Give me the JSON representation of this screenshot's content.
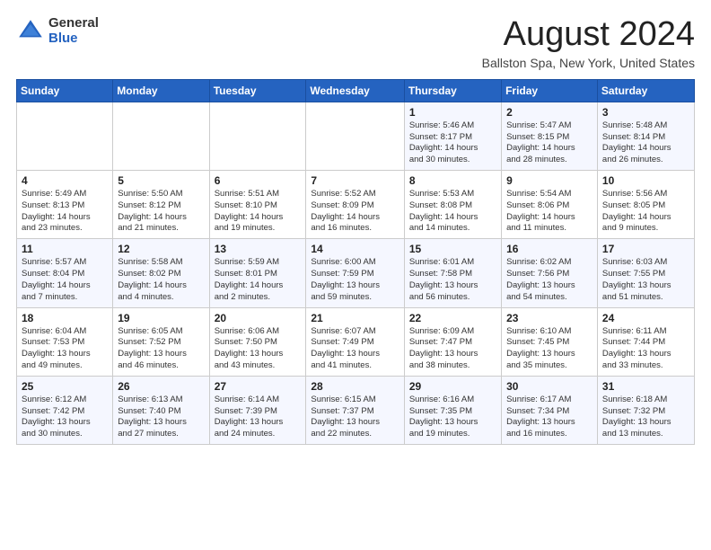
{
  "header": {
    "logo_general": "General",
    "logo_blue": "Blue",
    "month_title": "August 2024",
    "location": "Ballston Spa, New York, United States"
  },
  "weekdays": [
    "Sunday",
    "Monday",
    "Tuesday",
    "Wednesday",
    "Thursday",
    "Friday",
    "Saturday"
  ],
  "weeks": [
    [
      {
        "day": "",
        "info": ""
      },
      {
        "day": "",
        "info": ""
      },
      {
        "day": "",
        "info": ""
      },
      {
        "day": "",
        "info": ""
      },
      {
        "day": "1",
        "info": "Sunrise: 5:46 AM\nSunset: 8:17 PM\nDaylight: 14 hours\nand 30 minutes."
      },
      {
        "day": "2",
        "info": "Sunrise: 5:47 AM\nSunset: 8:15 PM\nDaylight: 14 hours\nand 28 minutes."
      },
      {
        "day": "3",
        "info": "Sunrise: 5:48 AM\nSunset: 8:14 PM\nDaylight: 14 hours\nand 26 minutes."
      }
    ],
    [
      {
        "day": "4",
        "info": "Sunrise: 5:49 AM\nSunset: 8:13 PM\nDaylight: 14 hours\nand 23 minutes."
      },
      {
        "day": "5",
        "info": "Sunrise: 5:50 AM\nSunset: 8:12 PM\nDaylight: 14 hours\nand 21 minutes."
      },
      {
        "day": "6",
        "info": "Sunrise: 5:51 AM\nSunset: 8:10 PM\nDaylight: 14 hours\nand 19 minutes."
      },
      {
        "day": "7",
        "info": "Sunrise: 5:52 AM\nSunset: 8:09 PM\nDaylight: 14 hours\nand 16 minutes."
      },
      {
        "day": "8",
        "info": "Sunrise: 5:53 AM\nSunset: 8:08 PM\nDaylight: 14 hours\nand 14 minutes."
      },
      {
        "day": "9",
        "info": "Sunrise: 5:54 AM\nSunset: 8:06 PM\nDaylight: 14 hours\nand 11 minutes."
      },
      {
        "day": "10",
        "info": "Sunrise: 5:56 AM\nSunset: 8:05 PM\nDaylight: 14 hours\nand 9 minutes."
      }
    ],
    [
      {
        "day": "11",
        "info": "Sunrise: 5:57 AM\nSunset: 8:04 PM\nDaylight: 14 hours\nand 7 minutes."
      },
      {
        "day": "12",
        "info": "Sunrise: 5:58 AM\nSunset: 8:02 PM\nDaylight: 14 hours\nand 4 minutes."
      },
      {
        "day": "13",
        "info": "Sunrise: 5:59 AM\nSunset: 8:01 PM\nDaylight: 14 hours\nand 2 minutes."
      },
      {
        "day": "14",
        "info": "Sunrise: 6:00 AM\nSunset: 7:59 PM\nDaylight: 13 hours\nand 59 minutes."
      },
      {
        "day": "15",
        "info": "Sunrise: 6:01 AM\nSunset: 7:58 PM\nDaylight: 13 hours\nand 56 minutes."
      },
      {
        "day": "16",
        "info": "Sunrise: 6:02 AM\nSunset: 7:56 PM\nDaylight: 13 hours\nand 54 minutes."
      },
      {
        "day": "17",
        "info": "Sunrise: 6:03 AM\nSunset: 7:55 PM\nDaylight: 13 hours\nand 51 minutes."
      }
    ],
    [
      {
        "day": "18",
        "info": "Sunrise: 6:04 AM\nSunset: 7:53 PM\nDaylight: 13 hours\nand 49 minutes."
      },
      {
        "day": "19",
        "info": "Sunrise: 6:05 AM\nSunset: 7:52 PM\nDaylight: 13 hours\nand 46 minutes."
      },
      {
        "day": "20",
        "info": "Sunrise: 6:06 AM\nSunset: 7:50 PM\nDaylight: 13 hours\nand 43 minutes."
      },
      {
        "day": "21",
        "info": "Sunrise: 6:07 AM\nSunset: 7:49 PM\nDaylight: 13 hours\nand 41 minutes."
      },
      {
        "day": "22",
        "info": "Sunrise: 6:09 AM\nSunset: 7:47 PM\nDaylight: 13 hours\nand 38 minutes."
      },
      {
        "day": "23",
        "info": "Sunrise: 6:10 AM\nSunset: 7:45 PM\nDaylight: 13 hours\nand 35 minutes."
      },
      {
        "day": "24",
        "info": "Sunrise: 6:11 AM\nSunset: 7:44 PM\nDaylight: 13 hours\nand 33 minutes."
      }
    ],
    [
      {
        "day": "25",
        "info": "Sunrise: 6:12 AM\nSunset: 7:42 PM\nDaylight: 13 hours\nand 30 minutes."
      },
      {
        "day": "26",
        "info": "Sunrise: 6:13 AM\nSunset: 7:40 PM\nDaylight: 13 hours\nand 27 minutes."
      },
      {
        "day": "27",
        "info": "Sunrise: 6:14 AM\nSunset: 7:39 PM\nDaylight: 13 hours\nand 24 minutes."
      },
      {
        "day": "28",
        "info": "Sunrise: 6:15 AM\nSunset: 7:37 PM\nDaylight: 13 hours\nand 22 minutes."
      },
      {
        "day": "29",
        "info": "Sunrise: 6:16 AM\nSunset: 7:35 PM\nDaylight: 13 hours\nand 19 minutes."
      },
      {
        "day": "30",
        "info": "Sunrise: 6:17 AM\nSunset: 7:34 PM\nDaylight: 13 hours\nand 16 minutes."
      },
      {
        "day": "31",
        "info": "Sunrise: 6:18 AM\nSunset: 7:32 PM\nDaylight: 13 hours\nand 13 minutes."
      }
    ]
  ]
}
